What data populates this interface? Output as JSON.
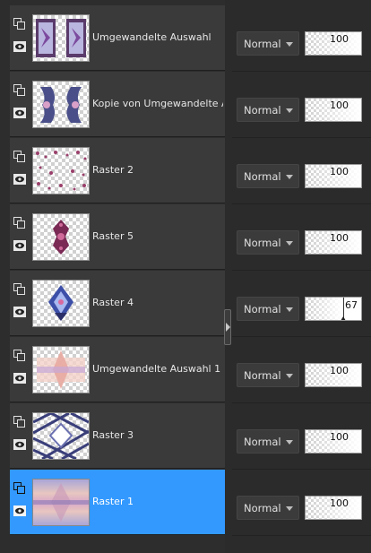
{
  "layers": [
    {
      "name": "Umgewandelte Auswahl",
      "blend": "Normal",
      "opacity": 100,
      "selected": false,
      "thumb": "frames"
    },
    {
      "name": "Kopie von Umgewandelte A",
      "blend": "Normal",
      "opacity": 100,
      "selected": false,
      "thumb": "pair"
    },
    {
      "name": "Raster 2",
      "blend": "Normal",
      "opacity": 100,
      "selected": false,
      "thumb": "scatter"
    },
    {
      "name": "Raster 5",
      "blend": "Normal",
      "opacity": 100,
      "selected": false,
      "thumb": "ornament"
    },
    {
      "name": "Raster 4",
      "blend": "Normal",
      "opacity": 67,
      "selected": false,
      "thumb": "diamond"
    },
    {
      "name": "Umgewandelte Auswahl 1",
      "blend": "Normal",
      "opacity": 100,
      "selected": false,
      "thumb": "soft"
    },
    {
      "name": "Raster 3",
      "blend": "Normal",
      "opacity": 100,
      "selected": false,
      "thumb": "lattice"
    },
    {
      "name": "Raster 1",
      "blend": "Normal",
      "opacity": 100,
      "selected": true,
      "thumb": "full"
    }
  ],
  "colors": {
    "selection": "#3399ff",
    "row_background": "#3a3a3a",
    "panel_background": "#2b2b2b"
  }
}
